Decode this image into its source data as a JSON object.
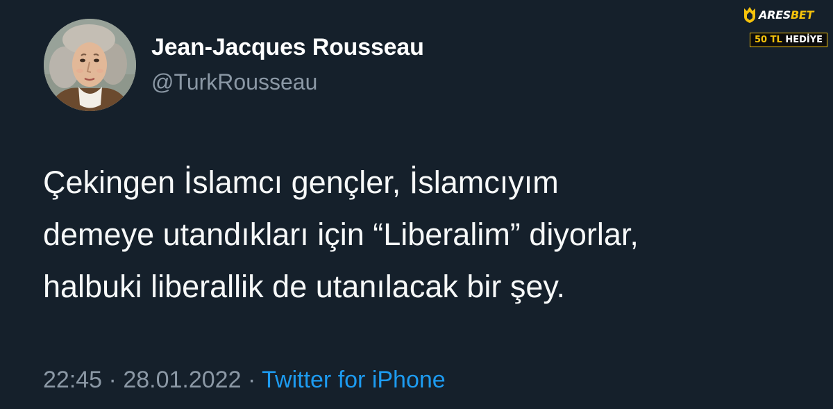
{
  "user": {
    "display_name": "Jean-Jacques Rousseau",
    "handle": "@TurkRousseau"
  },
  "tweet": {
    "lines": [
      "Çekingen İslamcı gençler, İslamcıyım",
      "demeye utandıkları için “Liberalim” diyorlar,",
      "halbuki liberallik de utanılacak bir şey."
    ],
    "time": "22:45",
    "date": "28.01.2022",
    "separator": "·",
    "source": "Twitter for iPhone"
  },
  "watermark": {
    "brand_main": "ARES",
    "brand_accent": "BET",
    "badge_number": "50 TL",
    "badge_text": "HEDİYE"
  },
  "colors": {
    "background": "#15202b",
    "secondary_text": "#8b98a5",
    "link": "#1d9bf0",
    "watermark_accent": "#f5c20b"
  }
}
